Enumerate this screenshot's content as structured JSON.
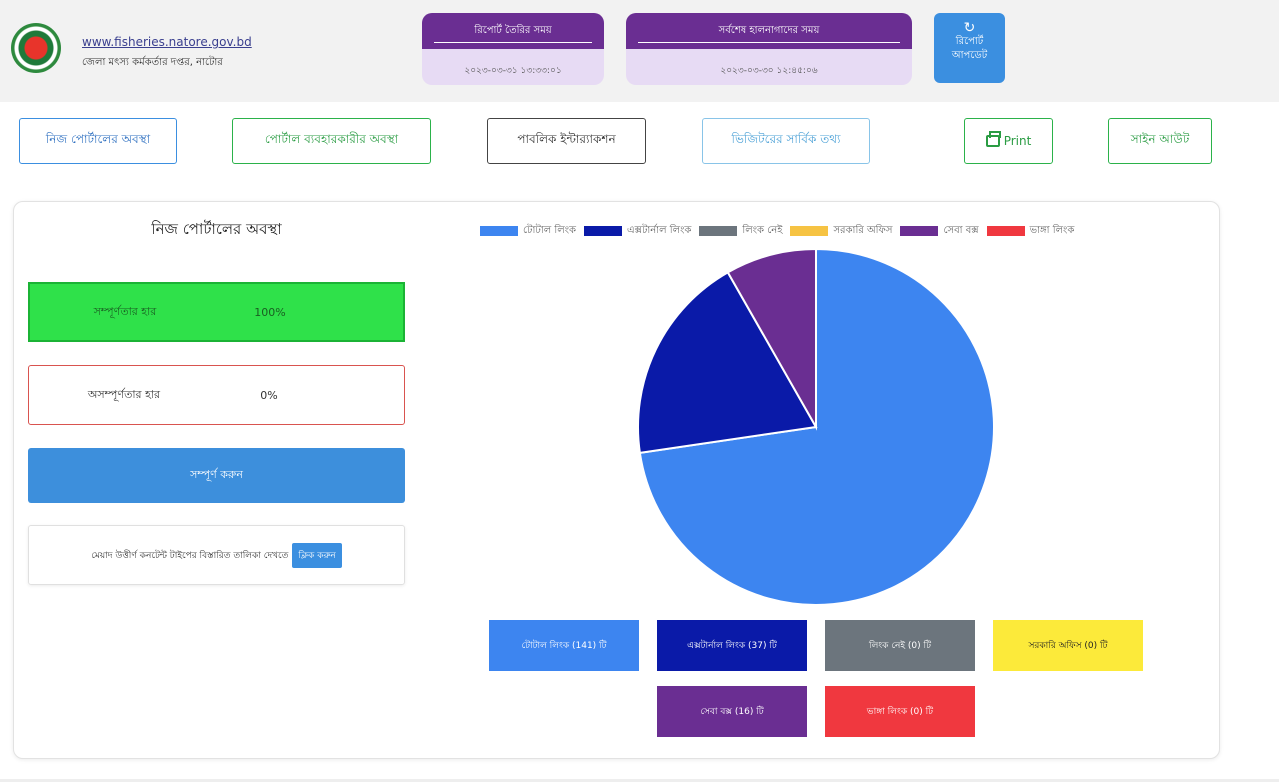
{
  "header": {
    "url": "www.fisheries.natore.gov.bd",
    "office": "জেলা মৎস্য কর্মকর্তার দপ্তর, নাটোর",
    "report_created": {
      "label": "রিপোর্ট তৈরির সময়",
      "value": "২০২৩-০৩-৩১ ১৩:৩৩:০১"
    },
    "last_updated": {
      "label": "সর্বশেষ হালনাগাদের সময়",
      "value": "২০২৩-০৩-৩০ ১২:৪৫:০৬"
    },
    "update_button": {
      "line1": "রিপোর্ট",
      "line2": "আপডেট",
      "icon": "refresh-icon"
    }
  },
  "nav": {
    "own_portal": "নিজ পোর্টালের অবস্থা",
    "portal_user": "পোর্টাল ব্যবহারকারীর অবস্থা",
    "public_interaction": "পাবলিক ইন্টার‍্যাকশন",
    "visitor_info": "ভিজিটরের সার্বিক তথ্য",
    "print": "Print",
    "signout": "সাইন আউট"
  },
  "panel": {
    "title": "নিজ পোর্টালের অবস্থা",
    "complete_rate": {
      "label": "সম্পূর্ণতার হার",
      "value": "100%"
    },
    "incomplete_rate": {
      "label": "অসম্পূর্ণতার হার",
      "value": "0%"
    },
    "complete_button": "সম্পূর্ণ করুন",
    "info_text": "মেয়াদ উত্তীর্ণ কনটেন্ট টাইপের বিস্তারিত তালিকা দেখতে",
    "info_button": "ক্লিক করুন",
    "colors": {
      "complete_bg": "#2fe14a",
      "incomplete_border": "#d9534f",
      "button": "#3d8fdc"
    }
  },
  "chart_data": {
    "type": "pie",
    "labels": [
      "টোটাল লিংক",
      "এক্সটার্নাল লিংক",
      "লিংক নেই",
      "সরকারি অফিস",
      "সেবা বক্স",
      "ভাঙ্গা লিংক"
    ],
    "values": [
      141,
      37,
      0,
      0,
      16,
      0
    ],
    "colors": [
      "#3d85f0",
      "#0a1aa8",
      "#6c757d",
      "#f6c343",
      "#6a2e92",
      "#f0383f"
    ]
  },
  "tiles": [
    {
      "text": "টোটাল লিংক (141) টি",
      "color": "#3d85f0"
    },
    {
      "text": "এক্সটার্নাল লিংক (37) টি",
      "color": "#0a1aa8"
    },
    {
      "text": "লিংক নেই (0) টি",
      "color": "#6c757d"
    },
    {
      "text": "সরকারি অফিস (0) টি",
      "color": "#fcea3a"
    },
    {
      "text": "সেবা বক্স (16) টি",
      "color": "#6a2e92"
    },
    {
      "text": "ভাঙ্গা লিংক (0) টি",
      "color": "#f0383f"
    }
  ]
}
